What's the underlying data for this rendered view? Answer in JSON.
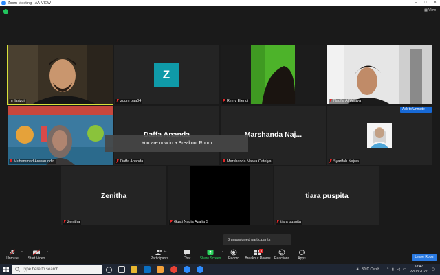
{
  "window": {
    "title": "Zoom Meeting - AA-VIEW"
  },
  "view_label": "View",
  "tiles": [
    {
      "id": "t1",
      "name": "m ilarizqi",
      "video": true,
      "active": true
    },
    {
      "id": "t2",
      "name": "zoom baa04",
      "avatar_letter": "Z",
      "avatar_color": "#0f9aa8"
    },
    {
      "id": "t3",
      "name": "Rinny Efendi",
      "video": true
    },
    {
      "id": "t4",
      "name": "Naufal Al Wijaya",
      "video": true
    },
    {
      "id": "t5",
      "name": "Muhammad Anwaruddin",
      "video": true
    },
    {
      "id": "t6",
      "name": "Daffa Ananda",
      "big_name": "Daffa Ananda"
    },
    {
      "id": "t7",
      "name": "Marshanda Najwa Catelya",
      "big_name": "Marshanda  Naj..."
    },
    {
      "id": "t8",
      "name": "Syarifah Najwa",
      "photo": true
    },
    {
      "id": "t9",
      "name": "Zenitha",
      "big_name": "Zenitha"
    },
    {
      "id": "t10",
      "name": "Gusti Nadia Azalia S",
      "video": true
    },
    {
      "id": "t11",
      "name": "tiara puspita",
      "big_name": "tiara puspita"
    }
  ],
  "breakout_message": "You are now in a Breakout Room",
  "ask_to_unmute": "Ask to Unmute",
  "more_label": "...",
  "unassigned_text": "3 unassigned participants",
  "toolbar": {
    "unmute": "Unmute",
    "start_video": "Start Video",
    "participants": "Participants",
    "participants_count": "11",
    "chat": "Chat",
    "share_screen": "Share Screen",
    "record": "Record",
    "breakout_rooms": "Breakout Rooms",
    "reactions": "Reactions",
    "apps": "Apps",
    "leave_room": "Leave Room"
  },
  "taskbar": {
    "search_placeholder": "Type here to search",
    "weather": "30°C  Cerah",
    "time": "18:47",
    "date": "22/03/2022"
  },
  "colors": {
    "accent_blue": "#2a7ae2",
    "share_green": "#2ad45c",
    "active_speaker": "#d8e23a",
    "mute_red": "#e02828"
  }
}
